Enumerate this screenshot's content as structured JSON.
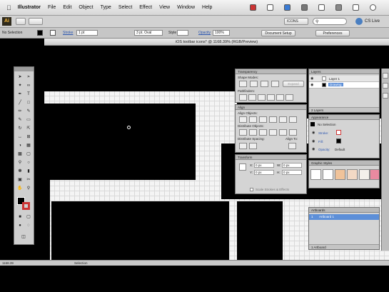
{
  "menubar": {
    "items": [
      "Illustrator",
      "File",
      "Edit",
      "Object",
      "Type",
      "Select",
      "Effect",
      "View",
      "Window",
      "Help"
    ]
  },
  "appbar": {
    "workspace_label": "ICONS",
    "cs_live_label": "CS Live"
  },
  "controlbar": {
    "selection_label": "No Selection",
    "stroke_label": "Stroke",
    "stroke_value": "1 pt",
    "brush_value": "3 pt. Oval",
    "style_label": "Style",
    "opacity_label": "Opacity",
    "opacity_value": "100%",
    "document_setup_label": "Document Setup",
    "preferences_label": "Preferences"
  },
  "document": {
    "tab_title": "iOS toolbar icons* @ 1168.39% (RGB/Preview)"
  },
  "status": {
    "zoom": "1168.39",
    "tool_name": "Selection"
  },
  "panels": {
    "transparency_tab": "Transparency",
    "shape_modes_label": "Shape Modes:",
    "expand_label": "Expand",
    "pathfinders_label": "Pathfinders:",
    "align_tab": "Align",
    "align_objects_label": "Align Objects:",
    "distribute_objects_label": "Distribute Objects:",
    "distribute_spacing_label": "Distribute Spacing:",
    "align_to_label": "Align To:",
    "transform_tab": "Transform",
    "transform_x": "0 px",
    "transform_y": "0 px",
    "transform_w": "0 px",
    "transform_h": "0 px",
    "scale_strokes_label": "Scale Strokes & Effects",
    "layers_tab": "Layers",
    "layer1": "Layer 1",
    "layer2": "Drawing",
    "layers_count": "2 Layers",
    "appearance_tab": "Appearance",
    "no_selection": "No Selection",
    "stroke_row": "Stroke:",
    "fill_row": "Fill:",
    "opacity_row": "Opacity:",
    "opacity_row_value": "Default",
    "graphic_styles_tab": "Graphic Styles",
    "artboards_tab": "Artboards",
    "artboard1": "Artboard 1",
    "artboards_count": "1 Artboard"
  },
  "colors": {
    "menubar_bg": "#e6e6e6",
    "canvas_bg": "#f4f4f4",
    "layer_highlight": "#5d8fd8",
    "swatch_orange": "#f0c39a",
    "swatch_pink": "#e98aa0"
  }
}
